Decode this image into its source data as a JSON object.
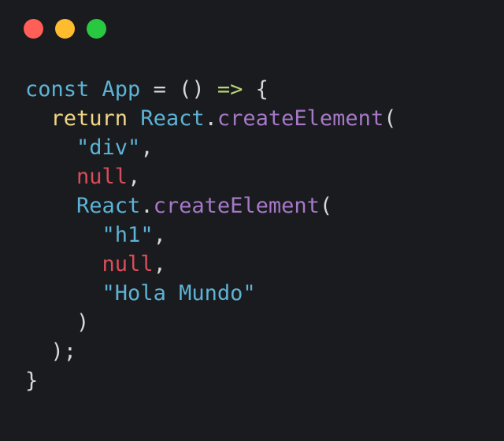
{
  "window": {
    "controls": [
      {
        "name": "close-button",
        "color": "#ff5f57"
      },
      {
        "name": "minimize-button",
        "color": "#febc2e"
      },
      {
        "name": "maximize-button",
        "color": "#28c840"
      }
    ]
  },
  "colors": {
    "keyword": "#5cb3d6",
    "return": "#f1d687",
    "method": "#a678c7",
    "string": "#5cb3d6",
    "null": "#d84d5a",
    "arrow": "#b8d57a",
    "plain": "#d7d7d7"
  },
  "code": {
    "lines": [
      [
        {
          "t": "const",
          "c": "keyword"
        },
        {
          "t": " ",
          "c": "plain"
        },
        {
          "t": "App",
          "c": "keyword"
        },
        {
          "t": " = () ",
          "c": "plain"
        },
        {
          "t": "=>",
          "c": "arrow"
        },
        {
          "t": " {",
          "c": "plain"
        }
      ],
      [
        {
          "t": "  ",
          "c": "plain"
        },
        {
          "t": "return",
          "c": "return"
        },
        {
          "t": " ",
          "c": "plain"
        },
        {
          "t": "React",
          "c": "keyword"
        },
        {
          "t": ".",
          "c": "plain"
        },
        {
          "t": "createElement",
          "c": "method"
        },
        {
          "t": "(",
          "c": "plain"
        }
      ],
      [
        {
          "t": "    ",
          "c": "plain"
        },
        {
          "t": "\"div\"",
          "c": "string"
        },
        {
          "t": ",",
          "c": "plain"
        }
      ],
      [
        {
          "t": "    ",
          "c": "plain"
        },
        {
          "t": "null",
          "c": "null"
        },
        {
          "t": ",",
          "c": "plain"
        }
      ],
      [
        {
          "t": "    ",
          "c": "plain"
        },
        {
          "t": "React",
          "c": "keyword"
        },
        {
          "t": ".",
          "c": "plain"
        },
        {
          "t": "createElement",
          "c": "method"
        },
        {
          "t": "(",
          "c": "plain"
        }
      ],
      [
        {
          "t": "      ",
          "c": "plain"
        },
        {
          "t": "\"h1\"",
          "c": "string"
        },
        {
          "t": ",",
          "c": "plain"
        }
      ],
      [
        {
          "t": "      ",
          "c": "plain"
        },
        {
          "t": "null",
          "c": "null"
        },
        {
          "t": ",",
          "c": "plain"
        }
      ],
      [
        {
          "t": "      ",
          "c": "plain"
        },
        {
          "t": "\"Hola Mundo\"",
          "c": "string"
        }
      ],
      [
        {
          "t": "    )",
          "c": "plain"
        }
      ],
      [
        {
          "t": "  );",
          "c": "plain"
        }
      ],
      [
        {
          "t": "}",
          "c": "plain"
        }
      ]
    ]
  }
}
